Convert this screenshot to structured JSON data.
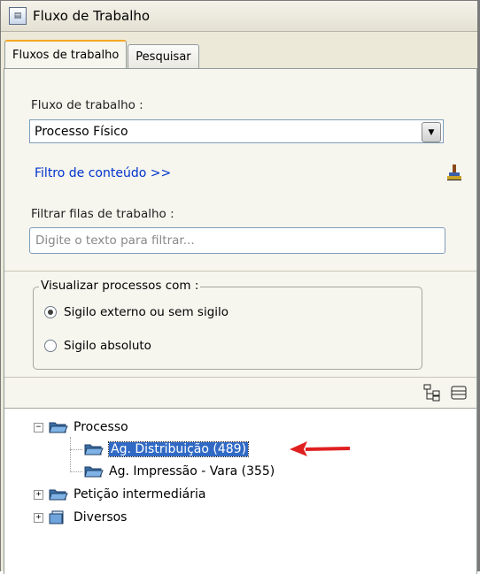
{
  "window": {
    "title": "Fluxo de Trabalho",
    "icon": "app-window-icon"
  },
  "tabs": [
    {
      "label": "Fluxos de trabalho",
      "active": true
    },
    {
      "label": "Pesquisar",
      "active": false
    }
  ],
  "workflow": {
    "label": "Fluxo de trabalho :",
    "selected": "Processo Físico"
  },
  "content_filter": {
    "link": "Filtro de conteúdo >>",
    "icon": "brush-icon"
  },
  "queue_filter": {
    "label": "Filtrar filas de trabalho :",
    "value": "",
    "placeholder": "Digite o texto para filtrar..."
  },
  "visibility": {
    "legend": "Visualizar processos com :",
    "options": [
      {
        "label": "Sigilo externo ou sem sigilo",
        "checked": true
      },
      {
        "label": "Sigilo absoluto",
        "checked": false
      }
    ]
  },
  "tree_toolbar": {
    "expand_icon": "tree-expand-icon",
    "collapse_icon": "tree-collapse-icon"
  },
  "tree": {
    "nodes": [
      {
        "label": "Processo",
        "expanded": true
      },
      {
        "label": "Ag. Distribuição (489)",
        "selected": true
      },
      {
        "label": "Ag. Impressão - Vara (355)"
      },
      {
        "label": "Petição intermediária",
        "expanded": false
      },
      {
        "label": "Diversos",
        "expanded": false
      }
    ]
  },
  "colors": {
    "link": "#0033cc",
    "selection": "#316ac5",
    "annotation_arrow": "#e02020",
    "tab_accent": "#f5a623"
  }
}
